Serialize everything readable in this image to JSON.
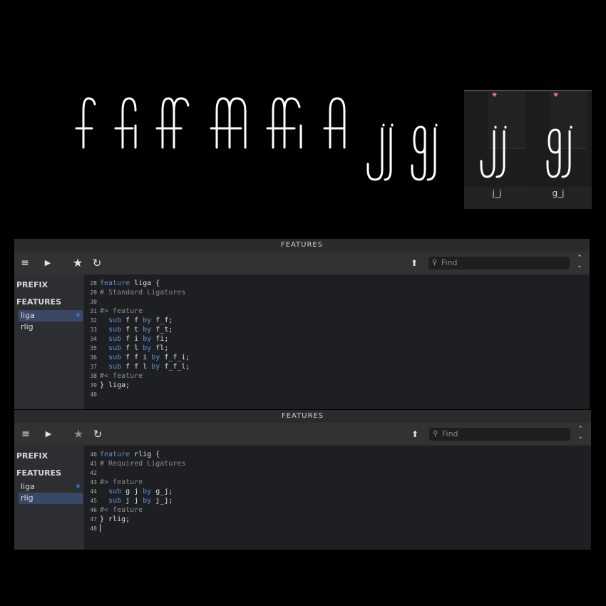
{
  "glyph_cells": [
    {
      "name": "j_j",
      "mark": "♥"
    },
    {
      "name": "g_j",
      "mark": "♥"
    }
  ],
  "panels": [
    {
      "title": "FEATURES",
      "find_placeholder": "Find",
      "sidebar": {
        "prefix_label": "PREFIX",
        "features_label": "FEATURES",
        "items": [
          {
            "label": "liga",
            "starred": true,
            "selected": true
          },
          {
            "label": "rlig",
            "starred": false,
            "selected": false
          }
        ]
      },
      "code": [
        {
          "n": "28",
          "parts": [
            [
              "kw",
              "feature"
            ],
            [
              "tx",
              " liga {"
            ]
          ]
        },
        {
          "n": "29",
          "parts": [
            [
              "cm",
              "# Standard Ligatures"
            ]
          ]
        },
        {
          "n": "30",
          "parts": []
        },
        {
          "n": "31",
          "parts": [
            [
              "cm",
              "#> feature"
            ]
          ]
        },
        {
          "n": "32",
          "parts": [
            [
              "tx",
              "  "
            ],
            [
              "kw",
              "sub"
            ],
            [
              "tx",
              " f f "
            ],
            [
              "kw",
              "by"
            ],
            [
              "tx",
              " f_f;"
            ]
          ]
        },
        {
          "n": "33",
          "parts": [
            [
              "tx",
              "  "
            ],
            [
              "kw",
              "sub"
            ],
            [
              "tx",
              " f t "
            ],
            [
              "kw",
              "by"
            ],
            [
              "tx",
              " f_t;"
            ]
          ]
        },
        {
          "n": "34",
          "parts": [
            [
              "tx",
              "  "
            ],
            [
              "kw",
              "sub"
            ],
            [
              "tx",
              " f i "
            ],
            [
              "kw",
              "by"
            ],
            [
              "tx",
              " fi;"
            ]
          ]
        },
        {
          "n": "35",
          "parts": [
            [
              "tx",
              "  "
            ],
            [
              "kw",
              "sub"
            ],
            [
              "tx",
              " f l "
            ],
            [
              "kw",
              "by"
            ],
            [
              "tx",
              " fl;"
            ]
          ]
        },
        {
          "n": "36",
          "parts": [
            [
              "tx",
              "  "
            ],
            [
              "kw",
              "sub"
            ],
            [
              "tx",
              " f f i "
            ],
            [
              "kw",
              "by"
            ],
            [
              "tx",
              " f_f_i;"
            ]
          ]
        },
        {
          "n": "37",
          "parts": [
            [
              "tx",
              "  "
            ],
            [
              "kw",
              "sub"
            ],
            [
              "tx",
              " f f l "
            ],
            [
              "kw",
              "by"
            ],
            [
              "tx",
              " f_f_l;"
            ]
          ]
        },
        {
          "n": "38",
          "parts": [
            [
              "cm",
              "#< feature"
            ]
          ]
        },
        {
          "n": "39",
          "parts": [
            [
              "tx",
              "} liga;"
            ]
          ]
        },
        {
          "n": "40",
          "parts": []
        }
      ]
    },
    {
      "title": "FEATURES",
      "find_placeholder": "Find",
      "sidebar": {
        "prefix_label": "PREFIX",
        "features_label": "FEATURES",
        "items": [
          {
            "label": "liga",
            "starred": true,
            "selected": false
          },
          {
            "label": "rlig",
            "starred": false,
            "selected": true
          }
        ]
      },
      "code": [
        {
          "n": "40",
          "parts": [
            [
              "kw",
              "feature"
            ],
            [
              "tx",
              " rlig {"
            ]
          ]
        },
        {
          "n": "41",
          "parts": [
            [
              "cm",
              "# Required Ligatures"
            ]
          ]
        },
        {
          "n": "42",
          "parts": []
        },
        {
          "n": "43",
          "parts": [
            [
              "cm",
              "#> feature"
            ]
          ]
        },
        {
          "n": "44",
          "parts": [
            [
              "tx",
              "  "
            ],
            [
              "kw",
              "sub"
            ],
            [
              "tx",
              " g j "
            ],
            [
              "kw",
              "by"
            ],
            [
              "tx",
              " g_j;"
            ]
          ]
        },
        {
          "n": "45",
          "parts": [
            [
              "tx",
              "  "
            ],
            [
              "kw",
              "sub"
            ],
            [
              "tx",
              " j j "
            ],
            [
              "kw",
              "by"
            ],
            [
              "tx",
              " j_j;"
            ]
          ]
        },
        {
          "n": "46",
          "parts": [
            [
              "cm",
              "#< feature"
            ]
          ]
        },
        {
          "n": "47",
          "parts": [
            [
              "tx",
              "} rlig;"
            ]
          ]
        },
        {
          "n": "48",
          "parts": [],
          "caret": true
        }
      ]
    }
  ],
  "icons": {
    "menu": "menu-icon",
    "run": "play-icon",
    "favorite": "star-icon",
    "refresh": "refresh-icon",
    "tree": "tree-icon",
    "search": "search-icon",
    "stepper": "stepper-icon"
  },
  "colors": {
    "keyword": "#5d8fd6",
    "comment": "#8b8b8b",
    "star_active": "#2f7bd8",
    "selection": "#3b4766",
    "glyph_mark": "#e06c8c"
  }
}
